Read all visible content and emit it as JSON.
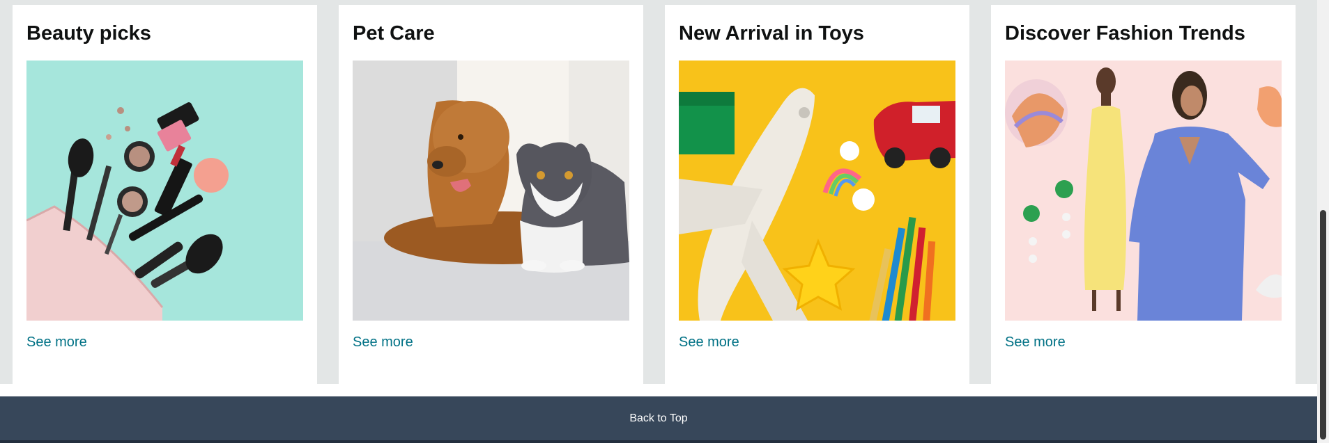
{
  "cards": [
    {
      "title": "Beauty picks",
      "link": "See more",
      "image": "cosmetics-bag-makeup-brushes-lipsticks"
    },
    {
      "title": "Pet Care",
      "link": "See more",
      "image": "golden-retriever-and-grey-white-cat"
    },
    {
      "title": "New Arrival in Toys",
      "link": "See more",
      "image": "toy-airplane-car-colored-pencils"
    },
    {
      "title": "Discover Fashion Trends",
      "link": "See more",
      "image": "models-yellow-dress-blue-suit-accessories"
    }
  ],
  "footer": {
    "back_to_top": "Back to Top"
  },
  "colors": {
    "link": "#007185",
    "footer_bg": "#37475a",
    "page_bg": "#e3e6e6"
  }
}
